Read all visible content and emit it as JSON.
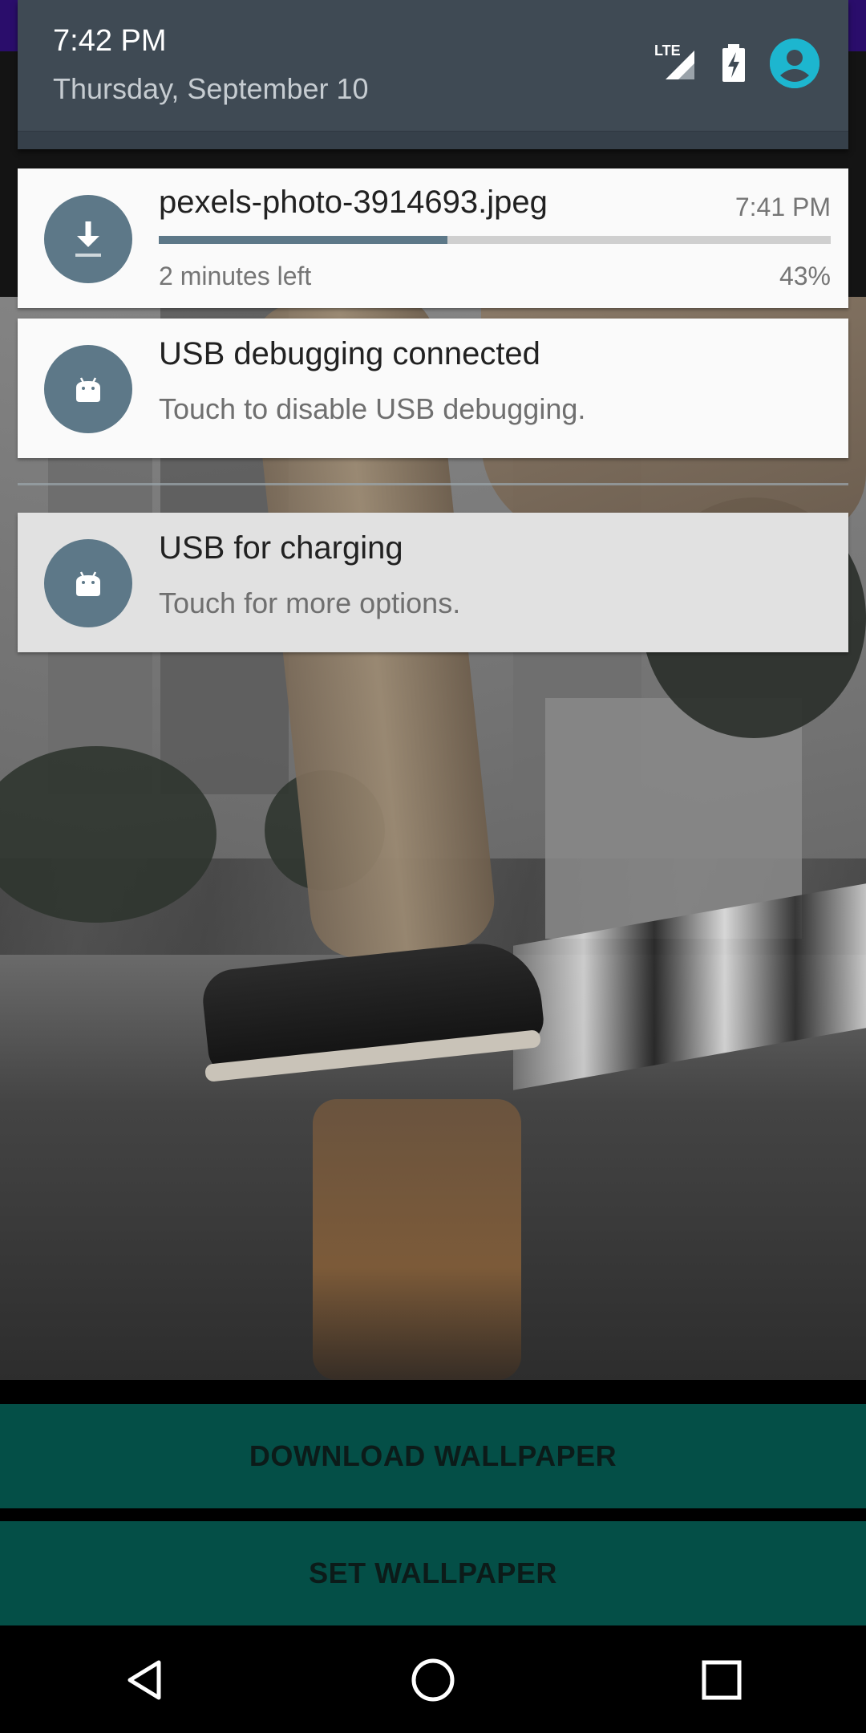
{
  "status_header": {
    "time": "7:42 PM",
    "date": "Thursday, September 10",
    "network_label": "LTE",
    "icons": [
      "lte-signal-icon",
      "battery-charging-icon",
      "user-avatar-icon"
    ]
  },
  "notifications": [
    {
      "icon": "download-icon",
      "title": "pexels-photo-3914693.jpeg",
      "time": "7:41 PM",
      "progress_percent": 43,
      "progress_label": "43%",
      "subtext": "2 minutes left"
    },
    {
      "icon": "android-icon",
      "title": "USB debugging connected",
      "text": "Touch to disable USB debugging."
    },
    {
      "icon": "android-icon",
      "title": "USB for charging",
      "text": "Touch for more options."
    }
  ],
  "app": {
    "download_button": "DOWNLOAD WALLPAPER",
    "set_button": "SET WALLPAPER"
  },
  "nav": {
    "icons": [
      "back-icon",
      "home-icon",
      "recents-icon"
    ]
  },
  "colors": {
    "shade_header": "#3f4a54",
    "notif_icon_bg": "#5d7888",
    "avatar": "#1db6cf",
    "app_button": "#044f47"
  }
}
